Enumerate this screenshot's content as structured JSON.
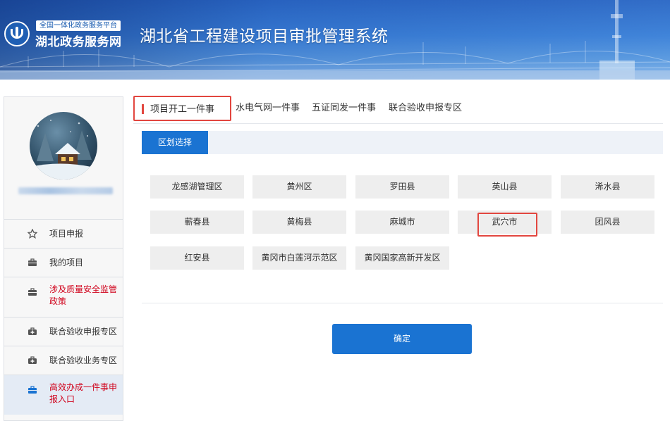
{
  "header": {
    "platform_sub": "全国一体化政务服务平台",
    "platform_name": "湖北政务服务网",
    "system_title": "湖北省工程建设项目审批管理系统"
  },
  "sidebar": {
    "username": "",
    "items": [
      {
        "label": "项目申报",
        "icon": "star-icon",
        "style": "normal"
      },
      {
        "label": "我的项目",
        "icon": "briefcase-icon",
        "style": "normal"
      },
      {
        "label": "涉及质量安全监管政策",
        "icon": "briefcase-icon",
        "style": "red"
      },
      {
        "label": "联合验收申报专区",
        "icon": "medical-case-icon",
        "style": "normal"
      },
      {
        "label": "联合验收业务专区",
        "icon": "medical-case-icon",
        "style": "normal"
      },
      {
        "label": "高效办成一件事申报入口",
        "icon": "briefcase-icon",
        "style": "red-active"
      }
    ]
  },
  "tabs": [
    {
      "label": "项目开工一件事",
      "active": true
    },
    {
      "label": "水电气网一件事",
      "active": false
    },
    {
      "label": "五证同发一件事",
      "active": false
    },
    {
      "label": "联合验收申报专区",
      "active": false
    }
  ],
  "region_section": {
    "label": "区划选择",
    "regions": [
      "龙感湖管理区",
      "黄州区",
      "罗田县",
      "英山县",
      "浠水县",
      "蕲春县",
      "黄梅县",
      "麻城市",
      "武穴市",
      "团风县",
      "红安县",
      "黄冈市白莲河示范区",
      "黄冈国家高新开发区"
    ],
    "highlighted": "武穴市"
  },
  "confirm_label": "确定",
  "colors": {
    "primary": "#1a73d2",
    "highlight_red": "#e2463f",
    "menu_red": "#d0021b"
  }
}
